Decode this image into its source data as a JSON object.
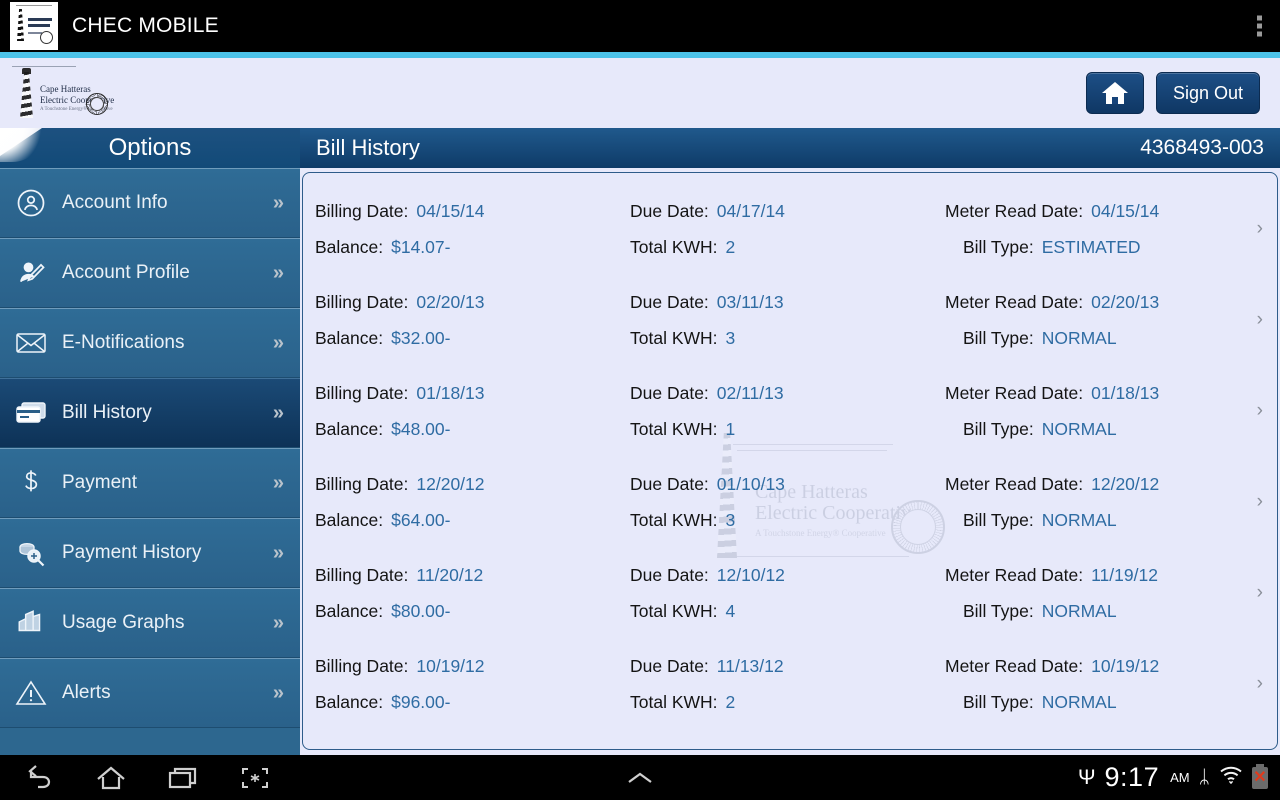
{
  "appbar": {
    "title": "CHEC MOBILE",
    "logo_icon": "lighthouse-logo",
    "overflow_icon": "overflow-menu-icon"
  },
  "webheader": {
    "brand_line1": "Cape Hatteras",
    "brand_line2": "Electric Cooperative",
    "brand_tagline": "A Touchstone Energy® Cooperative",
    "home_button_icon": "home-icon",
    "sign_out_label": "Sign Out"
  },
  "sidebar": {
    "header": "Options",
    "items": [
      {
        "label": "Account Info",
        "icon": "user-circle-icon",
        "selected": false
      },
      {
        "label": "Account Profile",
        "icon": "user-edit-icon",
        "selected": false
      },
      {
        "label": "E-Notifications",
        "icon": "envelope-icon",
        "selected": false
      },
      {
        "label": "Bill History",
        "icon": "credit-card-icon",
        "selected": true
      },
      {
        "label": "Payment",
        "icon": "dollar-icon",
        "selected": false
      },
      {
        "label": "Payment History",
        "icon": "coins-search-icon",
        "selected": false
      },
      {
        "label": "Usage Graphs",
        "icon": "bar-chart-icon",
        "selected": false
      },
      {
        "label": "Alerts",
        "icon": "warning-triangle-icon",
        "selected": false
      }
    ],
    "chevron": "»"
  },
  "content": {
    "title": "Bill History",
    "account_number": "4368493-003",
    "row_chevron": "›",
    "labels": {
      "billing_date": "Billing Date:",
      "due_date": "Due Date:",
      "meter_read_date": "Meter Read Date:",
      "balance": "Balance:",
      "total_kwh": "Total KWH:",
      "bill_type": "Bill Type:"
    },
    "watermark": {
      "line1": "Cape Hatteras",
      "line2": "Electric Cooperative",
      "tagline": "A Touchstone Energy® Cooperative"
    },
    "bills": [
      {
        "billing_date": "04/15/14",
        "due_date": "04/17/14",
        "meter_read_date": "04/15/14",
        "balance": "$14.07-",
        "total_kwh": "2",
        "bill_type": "ESTIMATED"
      },
      {
        "billing_date": "02/20/13",
        "due_date": "03/11/13",
        "meter_read_date": "02/20/13",
        "balance": "$32.00-",
        "total_kwh": "3",
        "bill_type": "NORMAL"
      },
      {
        "billing_date": "01/18/13",
        "due_date": "02/11/13",
        "meter_read_date": "01/18/13",
        "balance": "$48.00-",
        "total_kwh": "1",
        "bill_type": "NORMAL"
      },
      {
        "billing_date": "12/20/12",
        "due_date": "01/10/13",
        "meter_read_date": "12/20/12",
        "balance": "$64.00-",
        "total_kwh": "3",
        "bill_type": "NORMAL"
      },
      {
        "billing_date": "11/20/12",
        "due_date": "12/10/12",
        "meter_read_date": "11/19/12",
        "balance": "$80.00-",
        "total_kwh": "4",
        "bill_type": "NORMAL"
      },
      {
        "billing_date": "10/19/12",
        "due_date": "11/13/12",
        "meter_read_date": "10/19/12",
        "balance": "$96.00-",
        "total_kwh": "2",
        "bill_type": "NORMAL"
      }
    ]
  },
  "systembar": {
    "nav": [
      {
        "name": "back-icon"
      },
      {
        "name": "home-icon"
      },
      {
        "name": "recents-icon"
      },
      {
        "name": "screenshot-icon"
      }
    ],
    "expand_icon": "chevron-up-icon",
    "clock": "9:17",
    "meridiem": "AM",
    "icons": [
      "usb-icon",
      "bluetooth-icon",
      "wifi-icon",
      "battery-error-icon"
    ],
    "usb_glyph": "Ψ",
    "bluetooth_glyph": "ᛦ",
    "battery_x": "✕"
  },
  "colors": {
    "accent_stripe": "#4cc2e8",
    "page_bg": "#e7e9fa",
    "sidebar_bg": "#2d678f",
    "sidebar_selected": "#143f6b",
    "header_blue": "#14487a",
    "value_blue": "#2f6ca3"
  }
}
